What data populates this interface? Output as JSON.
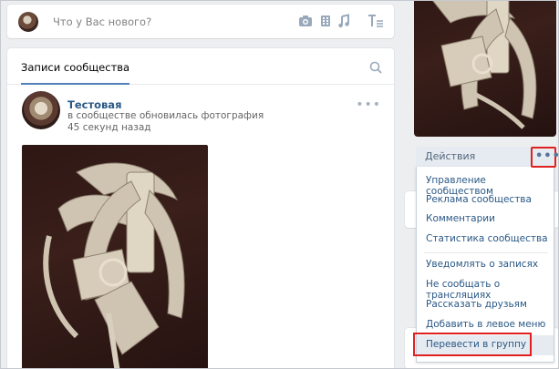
{
  "composer": {
    "placeholder": "Что у Вас нового?",
    "tools": [
      "camera-icon",
      "video-icon",
      "music-icon",
      "text-format-icon"
    ]
  },
  "feed": {
    "tab_active": "Записи сообщества"
  },
  "post": {
    "author": "Тестовая",
    "action": "в сообществе обновилась фотография",
    "time": "45 секунд назад",
    "more": "•••"
  },
  "actions": {
    "label": "Действия",
    "dots": "•••",
    "items": [
      "Управление сообществом",
      "Реклама сообщества",
      "Комментарии",
      "Статистика сообщества",
      "Уведомлять о записях",
      "Не сообщать о трансляциях",
      "Рассказать друзьям",
      "Добавить в левое меню",
      "Перевести в группу"
    ]
  },
  "colors": {
    "link": "#2a5885",
    "accent": "#5181b8",
    "highlight": "#e02020",
    "background": "#edeef0"
  }
}
